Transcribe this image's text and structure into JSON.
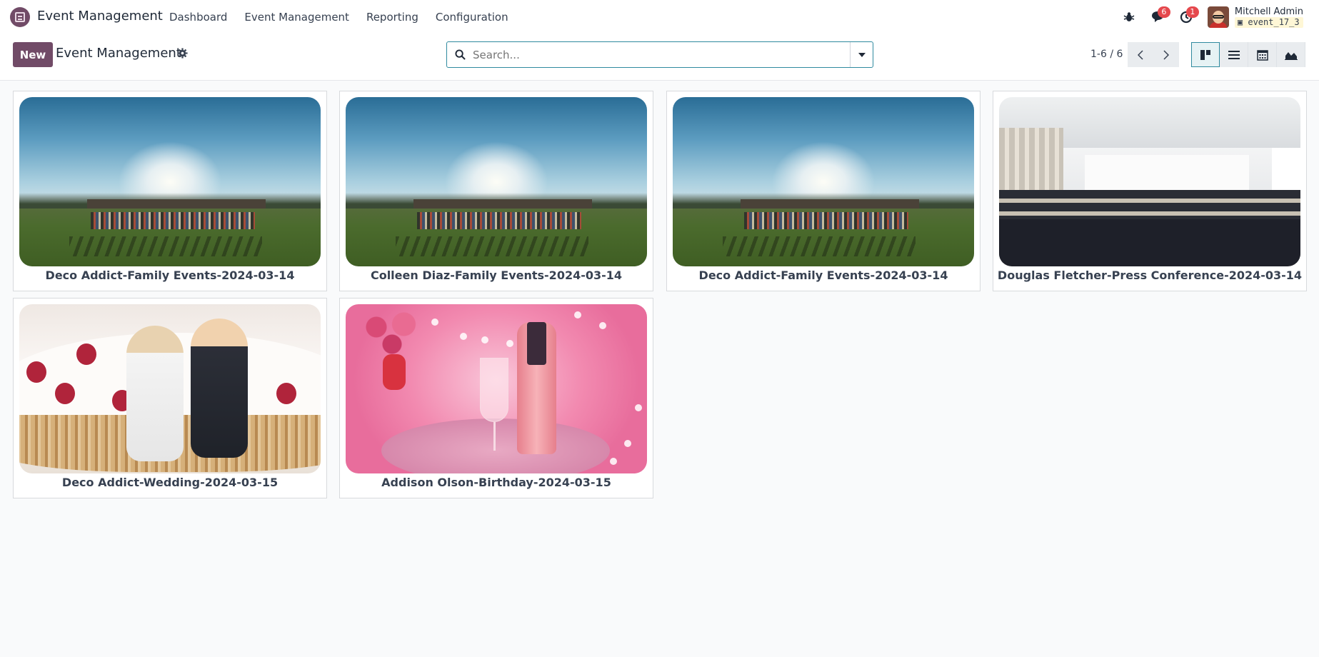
{
  "navbar": {
    "app_name": "Event Management",
    "menu": [
      "Dashboard",
      "Event Management",
      "Reporting",
      "Configuration"
    ],
    "messages_count": "6",
    "activities_count": "1",
    "user_name": "Mitchell Admin",
    "database": "event_17_3"
  },
  "control_panel": {
    "new_label": "New",
    "breadcrumb": "Event Management",
    "search_placeholder": "Search...",
    "pager": "1-6 / 6",
    "views": [
      "kanban-view",
      "list-view",
      "calendar-view",
      "graph-view"
    ],
    "active_view": "kanban-view"
  },
  "cards": [
    {
      "title": "Deco Addict-Family Events-2024-03-14",
      "image": "outdoor-crowd-field"
    },
    {
      "title": "Colleen Diaz-Family Events-2024-03-14",
      "image": "outdoor-crowd-field"
    },
    {
      "title": "Deco Addict-Family Events-2024-03-14",
      "image": "outdoor-crowd-field"
    },
    {
      "title": "Douglas Fletcher-Press Conference-2024-03-14",
      "image": "conference-room"
    },
    {
      "title": "Deco Addict-Wedding-2024-03-15",
      "image": "wedding-cake"
    },
    {
      "title": "Addison Olson-Birthday-2024-03-15",
      "image": "pink-celebration"
    }
  ],
  "colors": {
    "brand": "#714b67",
    "accent": "#2f8a9f",
    "badge": "#e5484d"
  }
}
